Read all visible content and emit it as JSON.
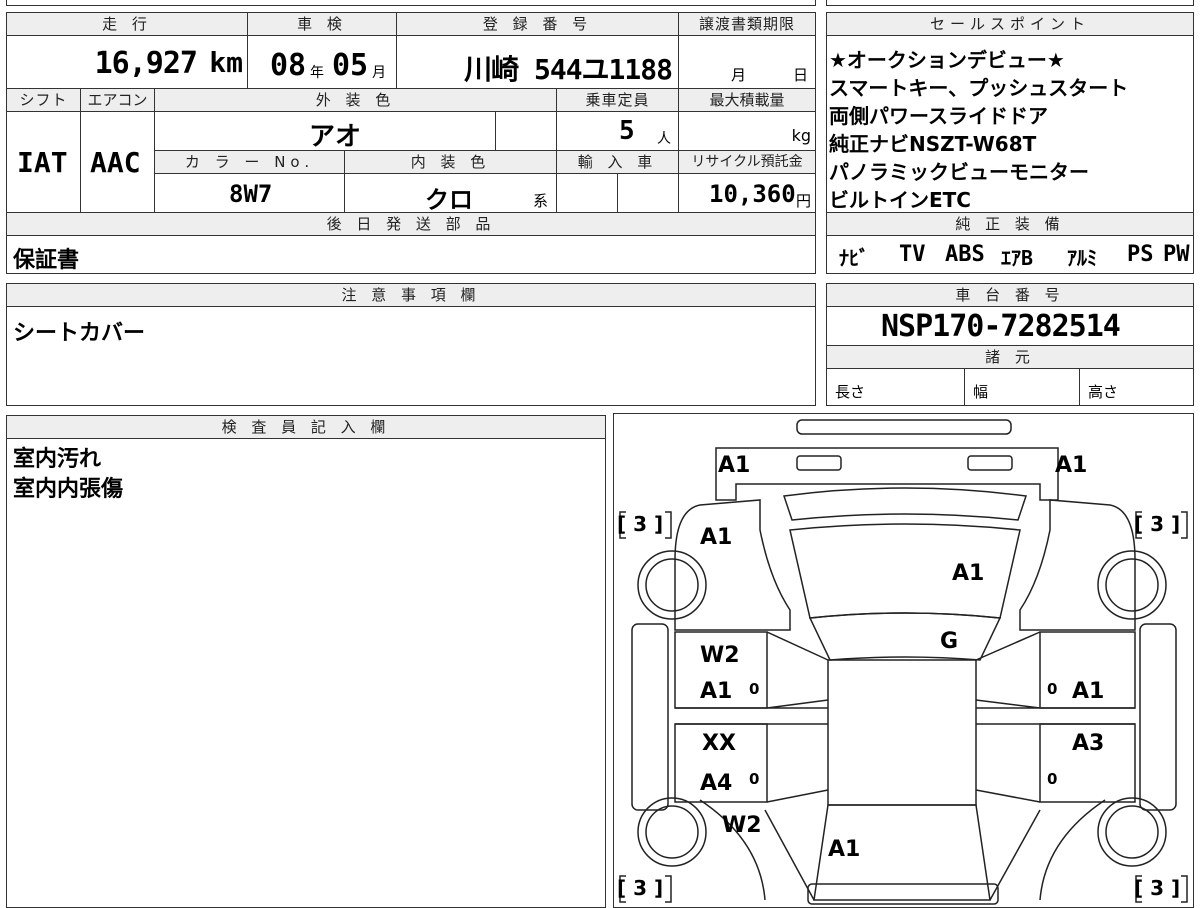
{
  "summary": {
    "mileage_label": "走 行",
    "mileage_value": "16,927",
    "mileage_unit": "km",
    "inspection_label": "車 検",
    "inspection_year": "08",
    "inspection_year_unit": "年",
    "inspection_month": "05",
    "inspection_month_unit": "月",
    "reg_label": "登 録 番 号",
    "reg_value": "川崎 544ユ1188",
    "transfer_label": "譲渡書類期限",
    "transfer_month": "月",
    "transfer_day": "日",
    "shift_label": "シフト",
    "shift_value": "IAT",
    "ac_label": "エアコン",
    "ac_value": "AAC",
    "exterior_label": "外 装 色",
    "exterior_value": "アオ",
    "capacity_label": "乗車定員",
    "capacity_value": "5",
    "capacity_unit": "人",
    "load_label": "最大積載量",
    "load_unit": "kg",
    "color_no_label": "カ ラ ー No.",
    "color_no_value": "8W7",
    "interior_label": "内 装 色",
    "interior_value": "クロ",
    "interior_suffix": "系",
    "import_label": "輸 入 車",
    "recycle_label": "リサイクル預託金",
    "recycle_value": "10,360",
    "recycle_unit": "円",
    "later_label": "後 日 発 送 部 品",
    "later_value": "保証書"
  },
  "sales": {
    "label": "セールスポイント",
    "lines": [
      "★オークションデビュー★",
      "スマートキー、プッシュスタート",
      "両側パワースライドドア",
      "純正ナビNSZT-W68T",
      "パノラミックビューモニター",
      "ビルトインETC"
    ]
  },
  "equipment": {
    "label": "純 正 装 備",
    "items": [
      "ﾅﾋﾞ",
      "TV",
      "ABS",
      "ｴｱB",
      "ｱﾙﾐ",
      "PS",
      "PW"
    ]
  },
  "notes": {
    "label": "注 意 事 項 欄",
    "value": "シートカバー"
  },
  "chassis": {
    "label": "車 台 番 号",
    "value": "NSP170-7282514",
    "spec_label": "諸 元",
    "length_label": "長さ",
    "width_label": "幅",
    "height_label": "高さ"
  },
  "inspector": {
    "label": "検 査 員 記 入 欄",
    "lines": [
      "室内汚れ",
      "室内内張傷"
    ]
  },
  "diagram": {
    "marks": {
      "front_left": "A1",
      "front_right": "A1",
      "left_fender": "A1",
      "bonnet": "A1",
      "windshield": "G",
      "left_front_door_1": "W2",
      "left_front_door_2": "A1",
      "right_front_door": "A1",
      "left_rear_door_1": "XX",
      "left_rear_door_2": "A4",
      "right_rear_door": "A3",
      "left_quarter": "W2",
      "rear": "A1",
      "tire_fl": "[ 3 ]",
      "tire_fr": "[ 3 ]",
      "tire_rl": "[ 3 ]",
      "tire_rr": "[ 3 ]",
      "zero_1": "0",
      "zero_2": "0",
      "zero_3": "0",
      "zero_4": "0"
    }
  }
}
